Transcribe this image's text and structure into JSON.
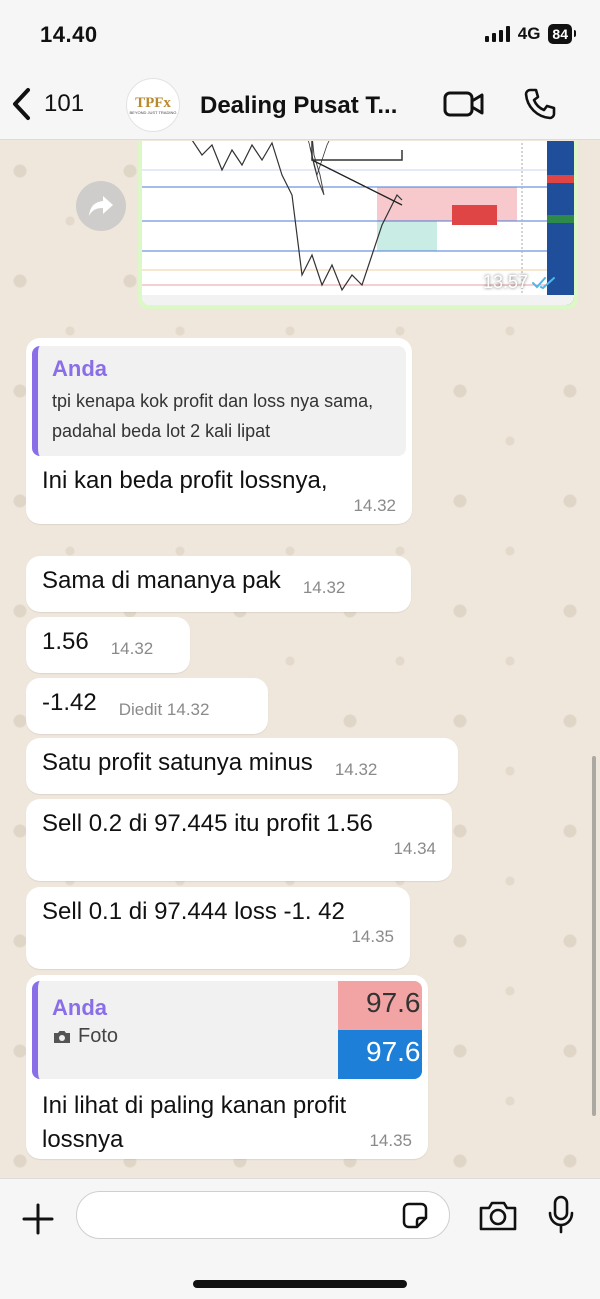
{
  "status_bar": {
    "time": "14.40",
    "network": "4G",
    "battery": "84"
  },
  "header": {
    "back_count": "101",
    "avatar_logo": "TPFx",
    "avatar_tagline": "BEYOND JUST TRADING",
    "title": "Dealing Pusat T..."
  },
  "chart_message": {
    "time": "13.57"
  },
  "messages": [
    {
      "quote_author": "Anda",
      "quote_text": "tpi kenapa kok profit dan loss nya sama, padahal beda lot 2 kali lipat",
      "text": "Ini kan beda profit lossnya,",
      "time": "14.32"
    },
    {
      "text": "Sama di mananya pak",
      "time": "14.32"
    },
    {
      "text": "1.56",
      "time": "14.32"
    },
    {
      "text": "-1.42",
      "edited": "Diedit",
      "time": "14.32"
    },
    {
      "text": "Satu profit satunya minus",
      "time": "14.32"
    },
    {
      "text": "Sell 0.2 di 97.445 itu profit 1.56",
      "time": "14.34"
    },
    {
      "text": "Sell 0.1 di 97.444 loss -1. 42",
      "time": "14.35"
    },
    {
      "quote_author": "Anda",
      "quote_label": "Foto",
      "thumb_top": "97.6",
      "thumb_bottom": "97.6",
      "text": "Ini lihat di paling kanan profit lossnya",
      "time": "14.35"
    }
  ],
  "input": {
    "placeholder": ""
  },
  "colors": {
    "quote_accent": "#8a6ee8",
    "sent_bubble": "#dcf8c6",
    "read_tick": "#4fb6ec"
  }
}
